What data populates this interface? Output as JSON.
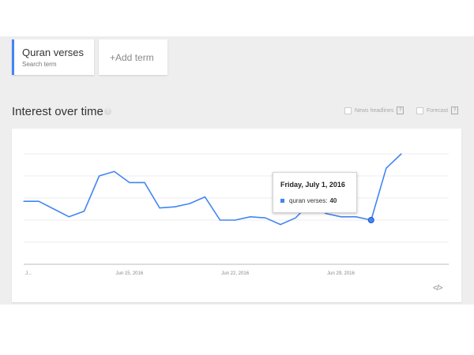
{
  "search_terms": [
    {
      "name": "Quran verses",
      "sublabel": "Search term",
      "color": "#4285f4"
    }
  ],
  "add_term_label": "+Add term",
  "section": {
    "title": "Interest over time",
    "help_glyph": "?"
  },
  "options": {
    "news_headlines": "News headlines",
    "forecast": "Forecast",
    "help_glyph": "?"
  },
  "tooltip": {
    "date": "Friday, July 1, 2016",
    "series_label": "quran verses:",
    "value": "40"
  },
  "embed_glyph": "</>",
  "chart_data": {
    "type": "line",
    "x_tick_labels": [
      "J...",
      "Jun 15, 2016",
      "Jun 22, 2016",
      "Jun 29, 2016"
    ],
    "x": [
      "Jun 8",
      "Jun 9",
      "Jun 10",
      "Jun 11",
      "Jun 12",
      "Jun 13",
      "Jun 14",
      "Jun 15",
      "Jun 16",
      "Jun 17",
      "Jun 18",
      "Jun 19",
      "Jun 20",
      "Jun 21",
      "Jun 22",
      "Jun 23",
      "Jun 24",
      "Jun 25",
      "Jun 26",
      "Jun 27",
      "Jun 28",
      "Jun 29",
      "Jun 30",
      "Jul 1",
      "Jul 2",
      "Jul 3"
    ],
    "series": [
      {
        "name": "quran verses",
        "color": "#4285f4",
        "values": [
          57,
          57,
          50,
          43,
          48,
          80,
          84,
          74,
          74,
          51,
          52,
          55,
          61,
          40,
          40,
          43,
          42,
          36,
          42,
          56,
          46,
          43,
          43,
          40,
          87,
          100
        ]
      }
    ],
    "highlight": {
      "x": "Jul 1",
      "value": 40
    },
    "ylim": [
      0,
      100
    ],
    "gridlines": 5,
    "legend": "none"
  }
}
